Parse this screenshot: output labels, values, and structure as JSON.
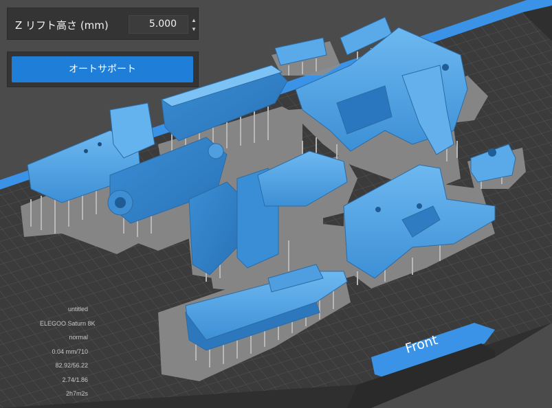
{
  "lift_panel": {
    "label": "Z リフト高さ (mm)",
    "value": "5.000",
    "step_up_icon": "triangle-up-icon",
    "step_down_icon": "triangle-down-icon"
  },
  "auto_support": {
    "button_label": "オートサポート"
  },
  "info": {
    "file_name": "untitled",
    "printer": "ELEGOO Saturn 8K",
    "mode": "normal",
    "layer": "0.04 mm/710",
    "volume": "82.92/56.22",
    "weight": "2.74/1.86",
    "time": "2h7m2s"
  },
  "viewport": {
    "front_label": "Front"
  },
  "colors": {
    "accent": "#1f7fd8",
    "model": "#4a9fe0",
    "build_plate": "#3a3a3a",
    "support_raft": "#8a8a8a",
    "plate_edge": "#3a93e6"
  }
}
